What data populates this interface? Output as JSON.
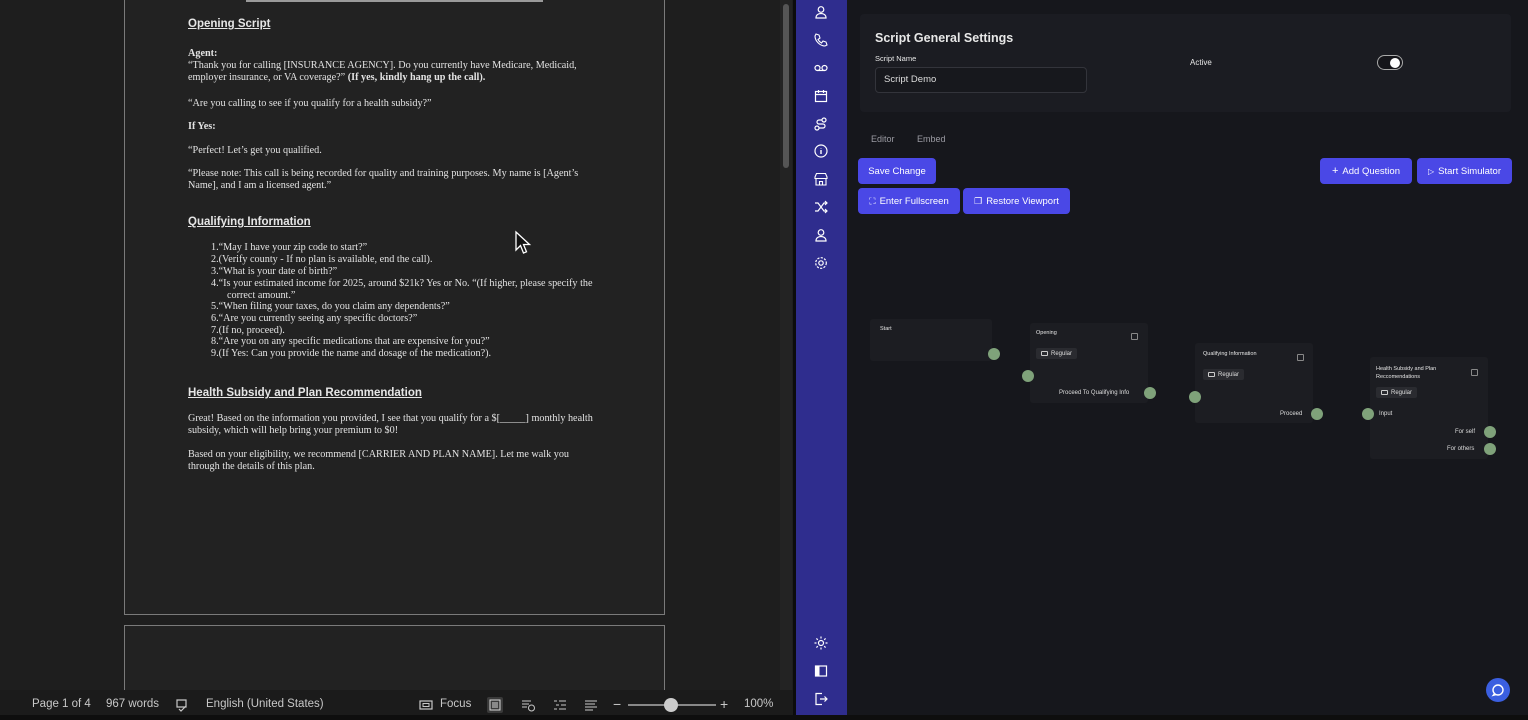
{
  "document": {
    "h_opening": "Opening Script",
    "agent_label": "Agent:",
    "agent_line1": "“Thank you for calling [INSURANCE AGENCY]. Do you currently have Medicare, Medicaid,",
    "agent_line2a": "employer insurance, or VA coverage?”",
    "agent_line2b": "(If yes, kindly hang up the call).",
    "subsidy_q": "“Are you calling to see if you qualify for a health subsidy?”",
    "if_yes": "If Yes:",
    "perfect": "“Perfect! Let’s get you qualified.",
    "note1": "“Please note: This call is being recorded for quality and training purposes. My name is [Agent’s",
    "note2": "Name], and I am a licensed agent.”",
    "h_qualifying": "Qualifying Information",
    "q_items": [
      "1.“May I have your zip code to start?”",
      "2.(Verify county - If no plan is available, end the call).",
      "3.“What is your date of birth?”",
      "4.“Is your estimated income for 2025, around $21k? Yes or No. “(If higher, please specify the",
      "correct amount.”",
      "5.“When filing your taxes, do you claim any dependents?”",
      "6.“Are you currently seeing any specific doctors?”",
      "7.(If no, proceed).",
      "8.“Are you on any specific medications that are expensive for you?”",
      "9.(If Yes: Can you provide the name and dosage of the medication?)."
    ],
    "h_health": "Health Subsidy and Plan Recommendation",
    "great1": "Great! Based on the information you provided, I see that you qualify for a $[_____] monthly health",
    "great2": "subsidy, which will help bring your premium to $0!",
    "elig1": "Based on your eligibility, we recommend [CARRIER AND PLAN NAME]. Let me walk you",
    "elig2": "through the details of this plan."
  },
  "statusbar": {
    "page": "Page 1 of 4",
    "words": "967 words",
    "language": "English (United States)",
    "focus": "Focus",
    "zoom": "100%"
  },
  "settings": {
    "title": "Script General Settings",
    "name_label": "Script Name",
    "name_value": "Script Demo",
    "active_label": "Active"
  },
  "tabs": {
    "editor": "Editor",
    "embed": "Embed"
  },
  "buttons": {
    "save": "Save Change",
    "add_question": "Add Question",
    "start_simulator": "Start Simulator",
    "fullscreen": "Enter Fullscreen",
    "restore": "Restore Viewport"
  },
  "flow": {
    "start": "Start",
    "opening": "Opening",
    "opening_badge": "Regular",
    "opening_out": "Proceed To Qualifying Info",
    "qualifying": "Qualifying Information",
    "qualifying_badge": "Regular",
    "qualifying_out": "Proceed",
    "health_1": "Health Subsidy and Plan",
    "health_2": "Reccomendations",
    "health_badge": "Regular",
    "health_in": "Input",
    "health_out1": "For self",
    "health_out2": "For others"
  }
}
